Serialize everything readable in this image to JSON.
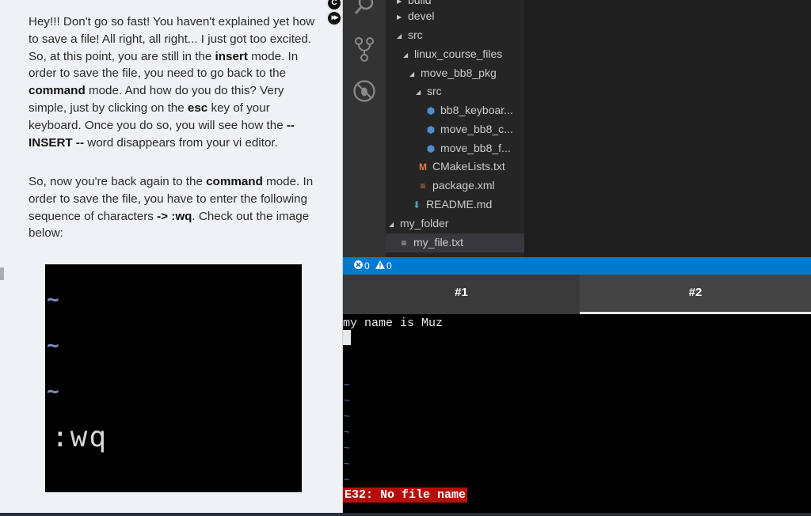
{
  "tutorial": {
    "para1": [
      {
        "t": "Hey!!! Don't go so fast! You haven't explained yet how to save a file! All right, all right... I just got too excited. So, at this point, you are still in the "
      },
      {
        "t": "insert",
        "b": true
      },
      {
        "t": " mode. In order to save the file, you need to go back to the "
      },
      {
        "t": "command",
        "b": true
      },
      {
        "t": " mode. And how do you do this? Very simple, just by clicking on the "
      },
      {
        "t": "esc",
        "b": true
      },
      {
        "t": " key of your keyboard. Once you do so, you will see how the "
      },
      {
        "t": "-- INSERT --",
        "b": true
      },
      {
        "t": " word disappears from your vi editor."
      }
    ],
    "para2": [
      {
        "t": "So, now you're back again to the "
      },
      {
        "t": "command",
        "b": true
      },
      {
        "t": " mode. In order to save the file, you have to enter the following sequence of characters "
      },
      {
        "t": "-> :wq",
        "b": true
      },
      {
        "t": ". Check out the image below:"
      }
    ],
    "image": {
      "tilde_glyph": "~",
      "command_text": ":wq"
    }
  },
  "controls": {
    "top_button_glyph": "C",
    "forward_button_glyph": "▶▶"
  },
  "activity_bar": {
    "icons": [
      "search-icon",
      "source-control-icon",
      "debug-icon"
    ]
  },
  "file_tree": {
    "items": [
      {
        "label": "build",
        "type": "folder",
        "expanded": false,
        "depth": 0
      },
      {
        "label": "devel",
        "type": "folder",
        "expanded": false,
        "depth": 0
      },
      {
        "label": "src",
        "type": "folder",
        "expanded": true,
        "depth": 0
      },
      {
        "label": "linux_course_files",
        "type": "folder",
        "expanded": true,
        "depth": 1
      },
      {
        "label": "move_bb8_pkg",
        "type": "folder",
        "expanded": true,
        "depth": 2
      },
      {
        "label": "src",
        "type": "folder",
        "expanded": true,
        "depth": 3
      },
      {
        "label": "bb8_keyboar...",
        "type": "python",
        "depth": 4
      },
      {
        "label": "move_bb8_c...",
        "type": "python",
        "depth": 4
      },
      {
        "label": "move_bb8_f...",
        "type": "python",
        "depth": 4
      },
      {
        "label": "CMakeLists.txt",
        "type": "cmake",
        "depth": 3
      },
      {
        "label": "package.xml",
        "type": "xml",
        "depth": 3
      },
      {
        "label": "README.md",
        "type": "markdown",
        "depth": 2
      },
      {
        "label": "my_folder",
        "type": "folder",
        "expanded": true,
        "depth": -1
      },
      {
        "label": "my_file.txt",
        "type": "text",
        "depth": -1,
        "selected": true
      }
    ]
  },
  "status_bar": {
    "errors": "0",
    "warnings": "0"
  },
  "terminal": {
    "tabs": [
      {
        "label": "#1",
        "active": false
      },
      {
        "label": "#2",
        "active": true
      }
    ],
    "content_line": "my name is Muz",
    "tilde_glyph": "~",
    "error_message": "E32: No file name"
  },
  "colors": {
    "status_bar": "#007acc",
    "error_bg": "#b80c0c",
    "python_icon": "#4d8fd0",
    "cmake_icon": "#e37933",
    "xml_icon": "#e37933",
    "markdown_icon": "#519aba"
  }
}
